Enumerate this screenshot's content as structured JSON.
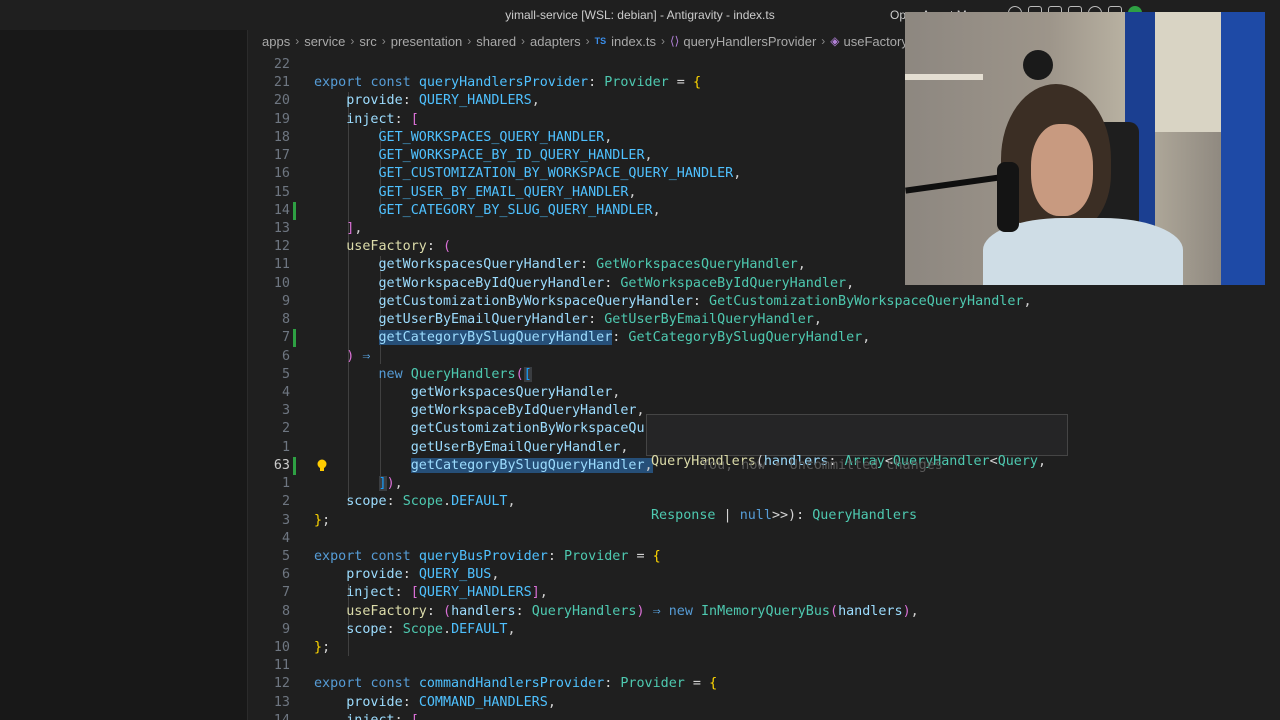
{
  "window": {
    "title": "yimall-service [WSL: debian] - Antigravity - index.ts",
    "agent_manager_label": "Open Agent Manager"
  },
  "breadcrumb": {
    "items": [
      "apps",
      "service",
      "src",
      "presentation",
      "shared",
      "adapters",
      "index.ts",
      "queryHandlersProvider",
      "useFactory"
    ],
    "file_icon_text": "TS"
  },
  "editor": {
    "lines": [
      {
        "ln": "22",
        "tokens": []
      },
      {
        "ln": "21",
        "tokens": [
          [
            "kw",
            "export "
          ],
          [
            "kw",
            "const "
          ],
          [
            "cn",
            "queryHandlersProvider"
          ],
          [
            "pn",
            ": "
          ],
          [
            "ty",
            "Provider"
          ],
          [
            "pn",
            " = "
          ],
          [
            "b1",
            "{"
          ]
        ]
      },
      {
        "ln": "20",
        "tokens": [
          [
            "pn",
            "    "
          ],
          [
            "vr",
            "provide"
          ],
          [
            "pn",
            ": "
          ],
          [
            "cn",
            "QUERY_HANDLERS"
          ],
          [
            "pn",
            ","
          ]
        ]
      },
      {
        "ln": "19",
        "tokens": [
          [
            "pn",
            "    "
          ],
          [
            "vr",
            "inject"
          ],
          [
            "pn",
            ": "
          ],
          [
            "b2",
            "["
          ]
        ]
      },
      {
        "ln": "18",
        "tokens": [
          [
            "pn",
            "        "
          ],
          [
            "cn",
            "GET_WORKSPACES_QUERY_HANDLER"
          ],
          [
            "pn",
            ","
          ]
        ]
      },
      {
        "ln": "17",
        "tokens": [
          [
            "pn",
            "        "
          ],
          [
            "cn",
            "GET_WORKSPACE_BY_ID_QUERY_HANDLER"
          ],
          [
            "pn",
            ","
          ]
        ]
      },
      {
        "ln": "16",
        "tokens": [
          [
            "pn",
            "        "
          ],
          [
            "cn",
            "GET_CUSTOMIZATION_BY_WORKSPACE_QUERY_HANDLER"
          ],
          [
            "pn",
            ","
          ]
        ]
      },
      {
        "ln": "15",
        "tokens": [
          [
            "pn",
            "        "
          ],
          [
            "cn",
            "GET_USER_BY_EMAIL_QUERY_HANDLER"
          ],
          [
            "pn",
            ","
          ]
        ]
      },
      {
        "ln": "14",
        "mod": true,
        "tokens": [
          [
            "pn",
            "        "
          ],
          [
            "cn",
            "GET_CATEGORY_BY_SLUG_QUERY_HANDLER"
          ],
          [
            "pn",
            ","
          ]
        ]
      },
      {
        "ln": "13",
        "tokens": [
          [
            "pn",
            "    "
          ],
          [
            "b2",
            "]"
          ],
          [
            "pn",
            ","
          ]
        ]
      },
      {
        "ln": "12",
        "tokens": [
          [
            "pn",
            "    "
          ],
          [
            "fn",
            "useFactory"
          ],
          [
            "pn",
            ": "
          ],
          [
            "b2",
            "("
          ]
        ]
      },
      {
        "ln": "11",
        "tokens": [
          [
            "pn",
            "        "
          ],
          [
            "vr",
            "getWorkspacesQueryHandler"
          ],
          [
            "pn",
            ": "
          ],
          [
            "ty",
            "GetWorkspacesQueryHandler"
          ],
          [
            "pn",
            ","
          ]
        ]
      },
      {
        "ln": "10",
        "tokens": [
          [
            "pn",
            "        "
          ],
          [
            "vr",
            "getWorkspaceByIdQueryHandler"
          ],
          [
            "pn",
            ": "
          ],
          [
            "ty",
            "GetWorkspaceByIdQueryHandler"
          ],
          [
            "pn",
            ","
          ]
        ]
      },
      {
        "ln": "9",
        "tokens": [
          [
            "pn",
            "        "
          ],
          [
            "vr",
            "getCustomizationByWorkspaceQueryHandler"
          ],
          [
            "pn",
            ": "
          ],
          [
            "ty",
            "GetCustomizationByWorkspaceQueryHandler"
          ],
          [
            "pn",
            ","
          ]
        ]
      },
      {
        "ln": "8",
        "tokens": [
          [
            "pn",
            "        "
          ],
          [
            "vr",
            "getUserByEmailQueryHandler"
          ],
          [
            "pn",
            ": "
          ],
          [
            "ty",
            "GetUserByEmailQueryHandler"
          ],
          [
            "pn",
            ","
          ]
        ]
      },
      {
        "ln": "7",
        "mod": true,
        "tokens": [
          [
            "pn",
            "        "
          ],
          [
            "vr hl",
            "getCategoryBySlugQueryHandler"
          ],
          [
            "pn",
            ": "
          ],
          [
            "ty",
            "GetCategoryBySlugQueryHandler"
          ],
          [
            "pn",
            ","
          ]
        ]
      },
      {
        "ln": "6",
        "tokens": [
          [
            "pn",
            "    "
          ],
          [
            "b2",
            ")"
          ],
          [
            "pn",
            " "
          ],
          [
            "kw",
            "⇒"
          ]
        ]
      },
      {
        "ln": "5",
        "tokens": [
          [
            "pn",
            "        "
          ],
          [
            "kw",
            "new "
          ],
          [
            "ty",
            "QueryHandlers"
          ],
          [
            "b2",
            "("
          ],
          [
            "b3 sel",
            "["
          ]
        ]
      },
      {
        "ln": "4",
        "tokens": [
          [
            "pn",
            "            "
          ],
          [
            "vr",
            "getWorkspacesQueryHandler"
          ],
          [
            "pn",
            ","
          ]
        ]
      },
      {
        "ln": "3",
        "tokens": [
          [
            "pn",
            "            "
          ],
          [
            "vr",
            "getWorkspaceByIdQueryHandler"
          ],
          [
            "pn",
            ","
          ]
        ]
      },
      {
        "ln": "2",
        "tokens": [
          [
            "pn",
            "            "
          ],
          [
            "vr",
            "getCustomizationByWorkspaceQu"
          ]
        ]
      },
      {
        "ln": "1",
        "tokens": [
          [
            "pn",
            "            "
          ],
          [
            "vr",
            "getUserByEmailQueryHandler"
          ],
          [
            "pn",
            ","
          ]
        ]
      },
      {
        "ln": "63",
        "current": true,
        "mod": true,
        "bulb": true,
        "tokens": [
          [
            "pn",
            "            "
          ],
          [
            "vr hl",
            "getCategoryBySlugQueryHandler"
          ],
          [
            "pn hl",
            ","
          ]
        ]
      },
      {
        "ln": "1",
        "tokens": [
          [
            "pn",
            "        "
          ],
          [
            "b3 sel",
            "]"
          ],
          [
            "b2",
            ")"
          ],
          [
            "pn",
            ","
          ]
        ]
      },
      {
        "ln": "2",
        "tokens": [
          [
            "pn",
            "    "
          ],
          [
            "vr",
            "scope"
          ],
          [
            "pn",
            ": "
          ],
          [
            "ty",
            "Scope"
          ],
          [
            "pn",
            "."
          ],
          [
            "cn",
            "DEFAULT"
          ],
          [
            "pn",
            ","
          ]
        ]
      },
      {
        "ln": "3",
        "tokens": [
          [
            "b1",
            "}"
          ],
          [
            "pn",
            ";"
          ]
        ]
      },
      {
        "ln": "4",
        "tokens": []
      },
      {
        "ln": "5",
        "tokens": [
          [
            "kw",
            "export "
          ],
          [
            "kw",
            "const "
          ],
          [
            "cn",
            "queryBusProvider"
          ],
          [
            "pn",
            ": "
          ],
          [
            "ty",
            "Provider"
          ],
          [
            "pn",
            " = "
          ],
          [
            "b1",
            "{"
          ]
        ]
      },
      {
        "ln": "6",
        "tokens": [
          [
            "pn",
            "    "
          ],
          [
            "vr",
            "provide"
          ],
          [
            "pn",
            ": "
          ],
          [
            "cn",
            "QUERY_BUS"
          ],
          [
            "pn",
            ","
          ]
        ]
      },
      {
        "ln": "7",
        "tokens": [
          [
            "pn",
            "    "
          ],
          [
            "vr",
            "inject"
          ],
          [
            "pn",
            ": "
          ],
          [
            "b2",
            "["
          ],
          [
            "cn",
            "QUERY_HANDLERS"
          ],
          [
            "b2",
            "]"
          ],
          [
            "pn",
            ","
          ]
        ]
      },
      {
        "ln": "8",
        "tokens": [
          [
            "pn",
            "    "
          ],
          [
            "fn",
            "useFactory"
          ],
          [
            "pn",
            ": "
          ],
          [
            "b2",
            "("
          ],
          [
            "vr",
            "handlers"
          ],
          [
            "pn",
            ": "
          ],
          [
            "ty",
            "QueryHandlers"
          ],
          [
            "b2",
            ")"
          ],
          [
            "pn",
            " "
          ],
          [
            "kw",
            "⇒"
          ],
          [
            "pn",
            " "
          ],
          [
            "kw",
            "new "
          ],
          [
            "ty",
            "InMemoryQueryBus"
          ],
          [
            "b2",
            "("
          ],
          [
            "vr",
            "handlers"
          ],
          [
            "b2",
            ")"
          ],
          [
            "pn",
            ","
          ]
        ]
      },
      {
        "ln": "9",
        "tokens": [
          [
            "pn",
            "    "
          ],
          [
            "vr",
            "scope"
          ],
          [
            "pn",
            ": "
          ],
          [
            "ty",
            "Scope"
          ],
          [
            "pn",
            "."
          ],
          [
            "cn",
            "DEFAULT"
          ],
          [
            "pn",
            ","
          ]
        ]
      },
      {
        "ln": "10",
        "tokens": [
          [
            "b1",
            "}"
          ],
          [
            "pn",
            ";"
          ]
        ]
      },
      {
        "ln": "11",
        "tokens": []
      },
      {
        "ln": "12",
        "tokens": [
          [
            "kw",
            "export "
          ],
          [
            "kw",
            "const "
          ],
          [
            "cn",
            "commandHandlersProvider"
          ],
          [
            "pn",
            ": "
          ],
          [
            "ty",
            "Provider"
          ],
          [
            "pn",
            " = "
          ],
          [
            "b1",
            "{"
          ]
        ]
      },
      {
        "ln": "13",
        "tokens": [
          [
            "pn",
            "    "
          ],
          [
            "vr",
            "provide"
          ],
          [
            "pn",
            ": "
          ],
          [
            "cn",
            "COMMAND_HANDLERS"
          ],
          [
            "pn",
            ","
          ]
        ]
      },
      {
        "ln": "14",
        "tokens": [
          [
            "pn",
            "    "
          ],
          [
            "vr",
            "inject"
          ],
          [
            "pn",
            ": "
          ],
          [
            "b2",
            "["
          ]
        ]
      }
    ]
  },
  "hover": {
    "line1": [
      [
        "fn",
        "QueryHandlers"
      ],
      [
        "pn",
        "("
      ],
      [
        "vr",
        "handlers"
      ],
      [
        "pn",
        ": "
      ],
      [
        "ty",
        "Array"
      ],
      [
        "pn",
        "<"
      ],
      [
        "ty",
        "QueryHandler"
      ],
      [
        "pn",
        "<"
      ],
      [
        "ty",
        "Query"
      ],
      [
        "pn",
        ","
      ]
    ],
    "line2": [
      [
        "ty",
        "Response"
      ],
      [
        "pn",
        " | "
      ],
      [
        "kw",
        "null"
      ],
      [
        "pn",
        ">>): "
      ],
      [
        "ty",
        "QueryHandlers"
      ]
    ]
  },
  "blame": {
    "text": "You, now • Uncommitted changes"
  },
  "colors": {
    "background": "#1f1f1f",
    "modified_gutter": "#2ea043",
    "selection": "#264f78"
  }
}
